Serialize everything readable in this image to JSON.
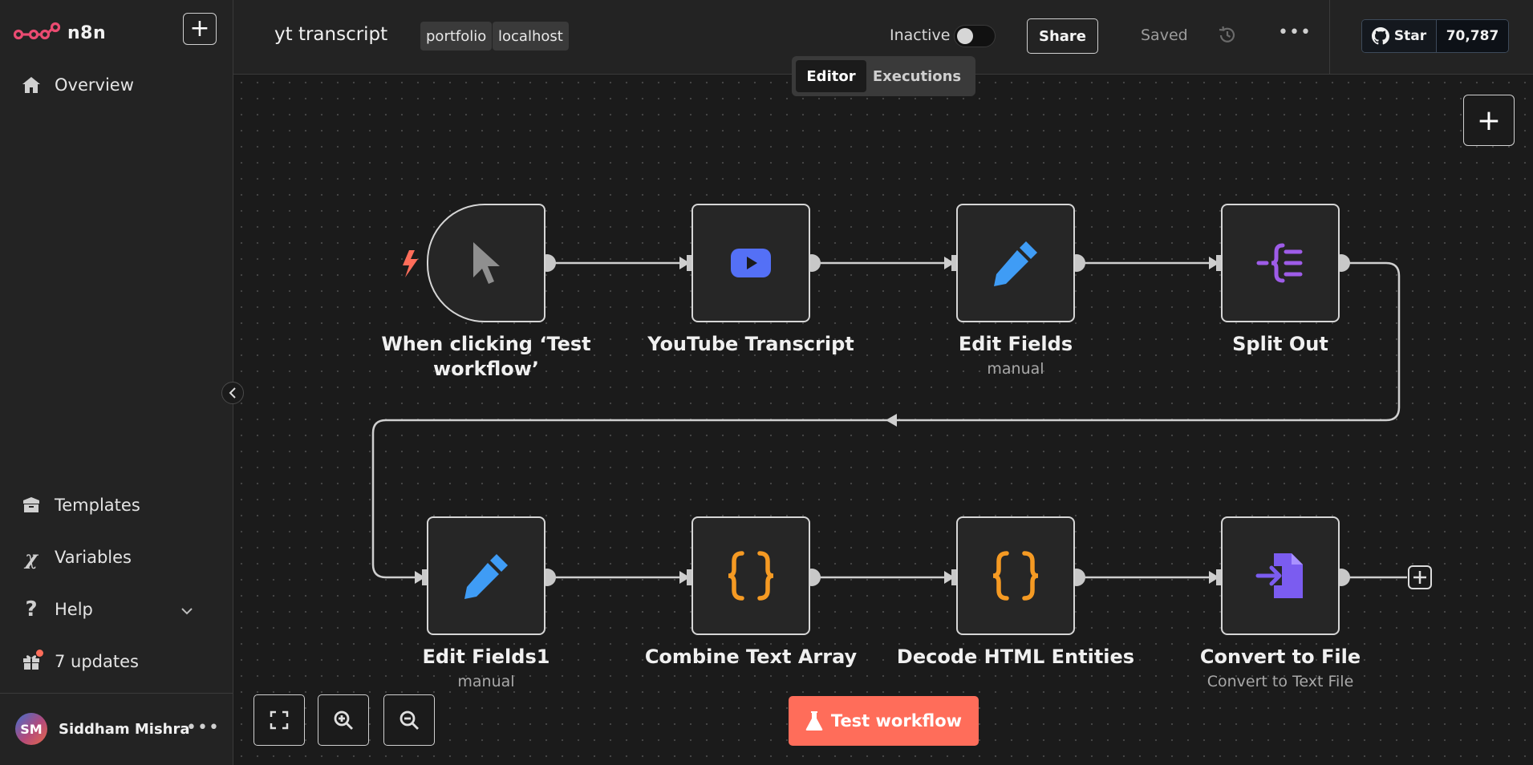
{
  "app": {
    "logo_text": "n8n",
    "new_button_label": "+"
  },
  "sidebar": {
    "top_items": [
      {
        "label": "Overview",
        "icon": "home-icon"
      }
    ],
    "bottom_items": [
      {
        "label": "Templates",
        "icon": "box-icon"
      },
      {
        "label": "Variables",
        "icon": "variable-icon"
      },
      {
        "label": "Help",
        "icon": "question-icon"
      },
      {
        "label": "7 updates",
        "icon": "gift-icon"
      }
    ],
    "user": {
      "initials": "SM",
      "name": "Siddham Mishra"
    }
  },
  "header": {
    "workflow_title": "yt transcript",
    "tags": [
      "portfolio",
      "localhost"
    ],
    "status_label": "Inactive",
    "active": false,
    "share_label": "Share",
    "saved_label": "Saved",
    "github": {
      "star_label": "Star",
      "star_count": "70,787"
    }
  },
  "tabs": [
    {
      "label": "Editor",
      "active": true
    },
    {
      "label": "Executions",
      "active": false
    }
  ],
  "nodes": [
    {
      "id": "trigger",
      "title": "When clicking ‘Test workflow’",
      "subtitle": "",
      "icon": "cursor-icon"
    },
    {
      "id": "youtube",
      "title": "YouTube Transcript",
      "subtitle": "",
      "icon": "youtube-icon"
    },
    {
      "id": "edit1",
      "title": "Edit Fields",
      "subtitle": "manual",
      "icon": "pencil-icon"
    },
    {
      "id": "split",
      "title": "Split Out",
      "subtitle": "",
      "icon": "split-out-icon"
    },
    {
      "id": "edit2",
      "title": "Edit Fields1",
      "subtitle": "manual",
      "icon": "pencil-icon"
    },
    {
      "id": "combine",
      "title": "Combine Text Array",
      "subtitle": "",
      "icon": "code-braces-icon"
    },
    {
      "id": "decode",
      "title": "Decode HTML Entities",
      "subtitle": "",
      "icon": "code-braces-icon"
    },
    {
      "id": "convert",
      "title": "Convert to File",
      "subtitle": "Convert to Text File",
      "icon": "file-import-icon"
    }
  ],
  "footer": {
    "test_button_label": "Test workflow"
  },
  "colors": {
    "accent": "#ff6d5a",
    "youtube_blue": "#5470f6",
    "pencil_blue": "#3f9cf5",
    "split_purple": "#9e5ce8",
    "code_orange": "#f59a23",
    "convert_purple": "#7b5cf0"
  }
}
